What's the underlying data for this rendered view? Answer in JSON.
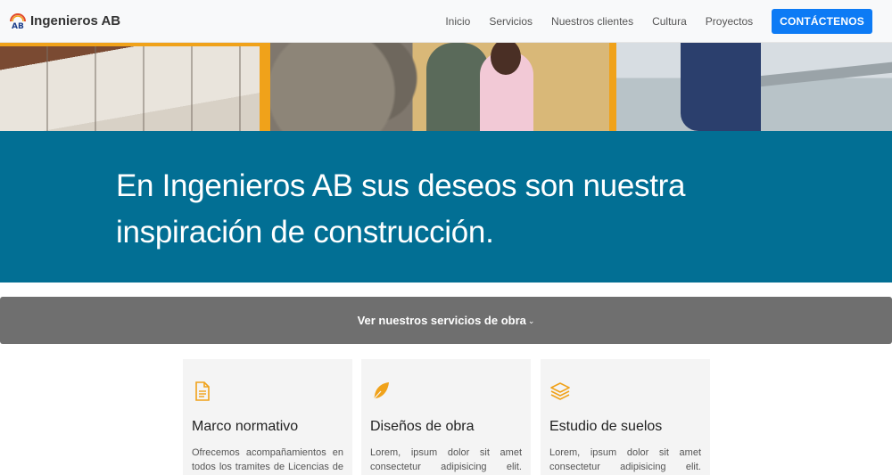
{
  "brand": {
    "name": "Ingenieros AB",
    "logo_icon": "ab-logo-icon"
  },
  "nav": {
    "links": [
      "Inicio",
      "Servicios",
      "Nuestros clientes",
      "Cultura",
      "Proyectos"
    ],
    "cta": "CONTÁCTENOS"
  },
  "hero": {
    "headline": "En Ingenieros AB sus deseos son nuestra inspiración de construcción."
  },
  "services_bar": {
    "label": "Ver nuestros servicios de obra",
    "icon": "chevron-down-icon"
  },
  "cards": [
    {
      "icon": "document-icon",
      "title": "Marco normativo",
      "text": "Ofrecemos acompañamientos en todos los tramites de Licencias de"
    },
    {
      "icon": "feather-icon",
      "title": "Diseños de obra",
      "text": "Lorem, ipsum dolor sit amet consectetur adipisicing elit."
    },
    {
      "icon": "layers-icon",
      "title": "Estudio de suelos",
      "text": "Lorem, ipsum dolor sit amet consectetur adipisicing elit."
    }
  ],
  "colors": {
    "accent": "#f0a21a",
    "brand_blue": "#026f94",
    "cta_blue": "#0d7bf5",
    "services_gray": "#6f6f6f"
  }
}
